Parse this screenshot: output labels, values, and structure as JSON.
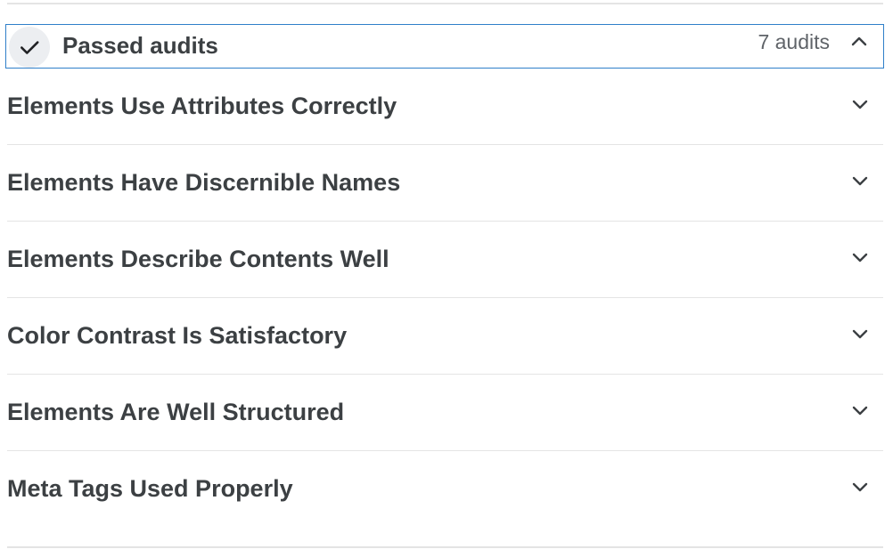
{
  "group": {
    "title": "Passed audits",
    "count_label": "7 audits",
    "icon": "check-icon",
    "collapse_icon": "chevron-up-icon",
    "border_color": "#2f7fc9"
  },
  "audits": [
    {
      "label": "Elements Use Attributes Correctly",
      "icon": "chevron-down-icon"
    },
    {
      "label": "Elements Have Discernible Names",
      "icon": "chevron-down-icon"
    },
    {
      "label": "Elements Describe Contents Well",
      "icon": "chevron-down-icon"
    },
    {
      "label": "Color Contrast Is Satisfactory",
      "icon": "chevron-down-icon"
    },
    {
      "label": "Elements Are Well Structured",
      "icon": "chevron-down-icon"
    },
    {
      "label": "Meta Tags Used Properly",
      "icon": "chevron-down-icon"
    }
  ]
}
